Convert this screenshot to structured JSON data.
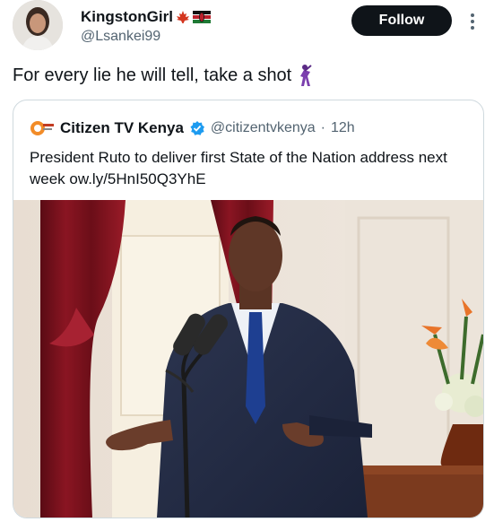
{
  "author": {
    "display_name": "KingstonGirl",
    "handle": "@Lsankei99"
  },
  "actions": {
    "follow_label": "Follow"
  },
  "tweet": {
    "text": "For every lie he will tell, take a shot"
  },
  "quoted_tweet": {
    "display_name": "Citizen TV Kenya",
    "handle": "@citizentvkenya",
    "separator": "·",
    "time": "12h",
    "text": "President Ruto to deliver first State of the Nation address next week ow.ly/5HnI50Q3YhE"
  },
  "colors": {
    "follow_bg": "#0f1419",
    "verified": "#1d9bf0",
    "secondary_text": "#536471",
    "border": "#cfd9de"
  },
  "icons": [
    "maple-leaf-icon",
    "kenya-flag-icon",
    "more-icon",
    "dancer-icon",
    "citizen-logo-icon",
    "verified-badge-icon"
  ]
}
